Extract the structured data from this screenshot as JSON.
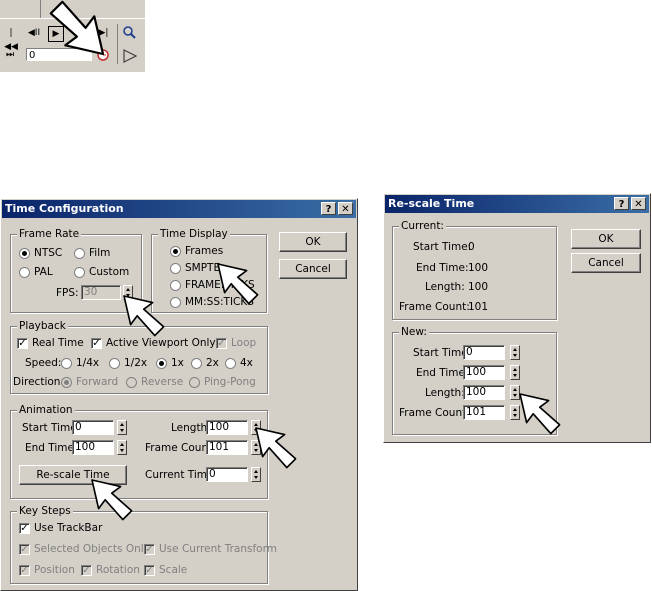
{
  "toolbar": {
    "buttons": [
      "|◀◀",
      "◀II",
      "▶",
      "▶▶|"
    ],
    "frame_value": "0",
    "icons": [
      "go-to-start-icon",
      "previous-frame-icon",
      "play-icon",
      "go-to-end-icon",
      "zoom-icon",
      "key-mode-icon",
      "time-config-icon",
      "select-arrow-icon"
    ]
  },
  "time_config": {
    "title": "Time Configuration",
    "help_btn": "?",
    "close_btn": "✕",
    "frame_rate": {
      "label": "Frame Rate",
      "ntsc": "NTSC",
      "film": "Film",
      "pal": "PAL",
      "custom": "Custom",
      "fps_label": "FPS:",
      "fps_value": "30"
    },
    "time_display": {
      "label": "Time Display",
      "frames": "Frames",
      "smpte": "SMPTE",
      "frame_ticks": "FRAME:TICKS",
      "mmss": "MM:SS:TICKS"
    },
    "ok": "OK",
    "cancel": "Cancel",
    "playback": {
      "label": "Playback",
      "real_time": "Real Time",
      "active_viewport": "Active Viewport Only",
      "loop": "Loop",
      "speed_label": "Speed:",
      "speeds": [
        "1/4x",
        "1/2x",
        "1x",
        "2x",
        "4x"
      ],
      "direction_label": "Direction:",
      "directions": [
        "Forward",
        "Reverse",
        "Ping-Pong"
      ]
    },
    "animation": {
      "label": "Animation",
      "start_label": "Start Time:",
      "start_value": "0",
      "end_label": "End Time:",
      "end_value": "100",
      "length_label": "Length:",
      "length_value": "100",
      "frame_count_label": "Frame Count:",
      "frame_count_value": "101",
      "rescale_btn": "Re-scale Time",
      "current_label": "Current Time:",
      "current_value": "0"
    },
    "key_steps": {
      "label": "Key Steps",
      "use_trackbar": "Use TrackBar",
      "selected_only": "Selected Objects Only",
      "use_current_transform": "Use Current Transform",
      "position": "Position",
      "rotation": "Rotation",
      "scale": "Scale"
    }
  },
  "rescale": {
    "title": "Re-scale Time",
    "help_btn": "?",
    "close_btn": "✕",
    "ok": "OK",
    "cancel": "Cancel",
    "current": {
      "label": "Current:",
      "start_label": "Start Time:",
      "start_value": "0",
      "end_label": "End Time:",
      "end_value": "100",
      "length_label": "Length:",
      "length_value": "100",
      "count_label": "Frame Count:",
      "count_value": "101"
    },
    "new": {
      "label": "New:",
      "start_label": "Start Time:",
      "start_value": "0",
      "end_label": "End Time:",
      "end_value": "100",
      "length_label": "Length:",
      "length_value": "100",
      "count_label": "Frame Count:",
      "count_value": "101"
    }
  },
  "colors": {
    "dialog_bg": "#d4d0c8",
    "title_start": "#0a246a",
    "title_end": "#3a6ea5",
    "arrow_fill": "#ffffff",
    "arrow_stroke": "#000000"
  }
}
